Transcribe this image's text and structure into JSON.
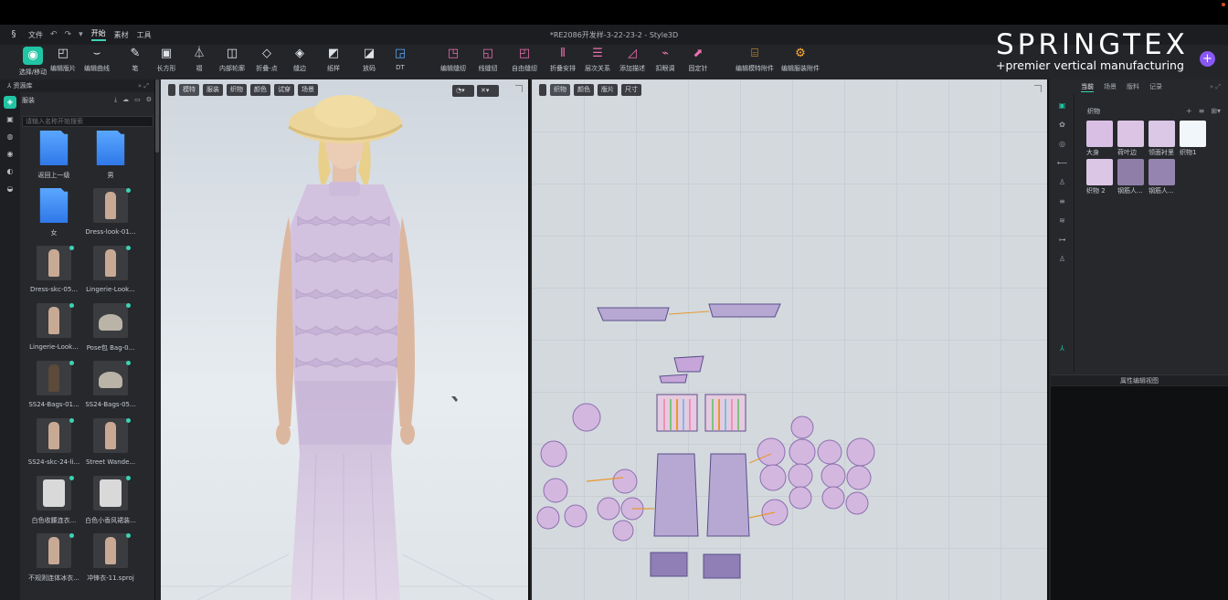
{
  "window": {
    "title": "*RE2086开发样-3-22-23-2 - Style3D",
    "menu": [
      "文件",
      "开始",
      "素材",
      "工具"
    ],
    "active_menu": "开始"
  },
  "toolbar": [
    {
      "icon": "select-move-icon",
      "label": "选择/移动",
      "selected": true
    },
    {
      "icon": "edit-pattern-icon",
      "label": "编辑版片"
    },
    {
      "icon": "edit-curve-icon",
      "label": "编辑曲线"
    },
    {
      "icon": "pen-icon",
      "label": "笔"
    },
    {
      "icon": "rectangle-icon",
      "label": "长方形"
    },
    {
      "icon": "pleat-icon",
      "label": "褶"
    },
    {
      "icon": "internal-line-icon",
      "label": "内部轮廓"
    },
    {
      "icon": "point-icon",
      "label": "折叠-点"
    },
    {
      "icon": "fold-icon",
      "label": "缝边"
    },
    {
      "icon": "pattern-icon",
      "label": "纸样"
    },
    {
      "icon": "fabric-icon",
      "label": "放码"
    },
    {
      "icon": "text-icon",
      "label": "DT"
    },
    {
      "icon": "sew-edit-icon",
      "label": "编辑缝纫"
    },
    {
      "icon": "sewing-line-icon",
      "label": "线缝纫"
    },
    {
      "icon": "free-sew-icon",
      "label": "自由缝纫"
    },
    {
      "icon": "seam-align-icon",
      "label": "折叠安排"
    },
    {
      "icon": "layer-icon",
      "label": "层次关系"
    },
    {
      "icon": "add-tag-icon",
      "label": "添加描述"
    },
    {
      "icon": "pin-icon",
      "label": "扣眼调"
    },
    {
      "icon": "export-icon",
      "label": "固定针"
    },
    {
      "icon": "edit-hardware-icon",
      "label": "编辑模特附件"
    },
    {
      "icon": "edit-gear-icon",
      "label": "编辑服装附件"
    }
  ],
  "left_panel": {
    "title": "资源库",
    "section": "服装",
    "search_placeholder": "请输入名称开始搜索",
    "assets": [
      {
        "name": "返回上一级",
        "kind": "folder"
      },
      {
        "name": "男",
        "kind": "folder"
      },
      {
        "name": "女",
        "kind": "folder"
      },
      {
        "name": "Dress-look-01...",
        "kind": "img"
      },
      {
        "name": "Dress-skc-05...",
        "kind": "img"
      },
      {
        "name": "Lingerie-Look...",
        "kind": "img"
      },
      {
        "name": "Lingerie-Look...",
        "kind": "img"
      },
      {
        "name": "Pose包 Bag-0...",
        "kind": "bag"
      },
      {
        "name": "SS24-Bags-01...",
        "kind": "dk"
      },
      {
        "name": "SS24-Bags-05...",
        "kind": "bag"
      },
      {
        "name": "SS24-skc-24-li...",
        "kind": "img"
      },
      {
        "name": "Street Wande...",
        "kind": "img"
      },
      {
        "name": "白色收腰连衣...",
        "kind": "gar"
      },
      {
        "name": "白色小香风裙装...",
        "kind": "gar"
      },
      {
        "name": "不规则连体冰衣...",
        "kind": "img"
      },
      {
        "name": "冲锋衣-11.sproj",
        "kind": "img"
      }
    ]
  },
  "viewport3d": {
    "tabs": [
      "模特",
      "服装",
      "织物",
      "颜色",
      "试穿",
      "场景"
    ]
  },
  "viewport2d": {
    "tabs": [
      "织物",
      "颜色",
      "版片",
      "尺寸"
    ]
  },
  "right_panel": {
    "tabs": [
      "当前",
      "场景",
      "版料",
      "记录"
    ],
    "active_tab": "当前",
    "section": "织物",
    "fabrics": [
      {
        "name": "大身",
        "color": "#d9bfe3"
      },
      {
        "name": "荷叶边",
        "color": "#dbc4e4"
      },
      {
        "name": "领面衬里",
        "color": "#dbc7e6"
      },
      {
        "name": "织物1",
        "color": "#f1f6fb"
      },
      {
        "name": "织物 2",
        "color": "#dcc6e6"
      },
      {
        "name": "钢筋人...",
        "color": "#8f7fa8"
      },
      {
        "name": "钢筋人...",
        "color": "#9684b0"
      }
    ],
    "property_title": "属性编辑视图"
  },
  "brand": {
    "name": "SPRINGTEX",
    "tagline": "+premier vertical manufacturing",
    "badge": "+"
  },
  "colors": {
    "accent": "#21c4a3",
    "panel": "#26282c",
    "dress": "#d5c4e0",
    "pattern_fill": "#b6a8d2"
  }
}
